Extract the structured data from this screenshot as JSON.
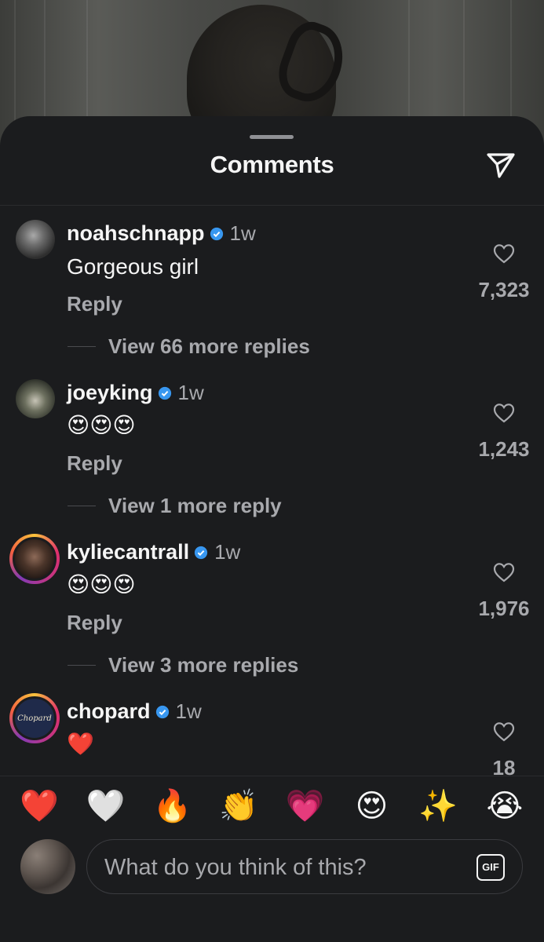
{
  "sheet": {
    "title": "Comments"
  },
  "comments": [
    {
      "username": "noahschnapp",
      "time": "1w",
      "text": "Gorgeous girl",
      "reply_label": "Reply",
      "likes": "7,323",
      "view_replies": "View 66 more replies"
    },
    {
      "username": "joeyking",
      "time": "1w",
      "text": "😍😍😍",
      "reply_label": "Reply",
      "likes": "1,243",
      "view_replies": "View 1 more reply"
    },
    {
      "username": "kyliecantrall",
      "time": "1w",
      "text": "😍😍😍",
      "reply_label": "Reply",
      "likes": "1,976",
      "view_replies": "View 3 more replies"
    },
    {
      "username": "chopard",
      "time": "1w",
      "text": "❤️",
      "likes": "18",
      "avatar_text": "Chopard"
    }
  ],
  "reactions": [
    "❤️",
    "🤍",
    "🔥",
    "👏",
    "💗",
    "😍",
    "✨",
    "😭"
  ],
  "composer": {
    "placeholder": "What do you think of this?",
    "gif_label": "GIF"
  },
  "colors": {
    "background": "#1b1c1e",
    "verified": "#3897f0",
    "secondary_text": "#a8a9ad"
  },
  "icons": [
    "share-icon",
    "verified-icon",
    "heart-icon",
    "gif-icon"
  ]
}
